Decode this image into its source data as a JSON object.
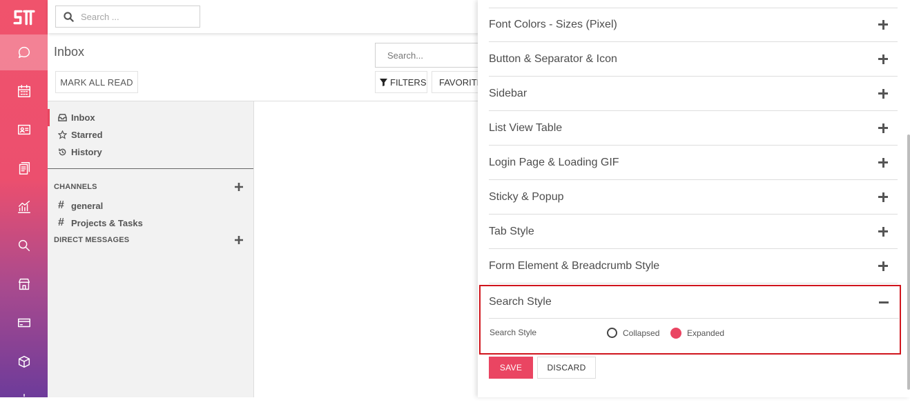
{
  "topbar": {
    "search_placeholder": "Search ..."
  },
  "appbar": {
    "items": [
      "discuss-icon",
      "calendar-icon",
      "contacts-icon",
      "documents-icon",
      "reports-icon",
      "search-icon",
      "store-icon",
      "card-icon",
      "package-icon",
      "settings-icon"
    ],
    "active": "discuss-icon"
  },
  "control_panel": {
    "title": "Inbox",
    "mark_all_read": "MARK ALL READ",
    "search_placeholder": "Search...",
    "filters_label": "FILTERS",
    "favorites_label": "FAVORITES"
  },
  "sidebar": {
    "mailboxes": [
      {
        "label": "Inbox",
        "icon": "inbox-icon",
        "active": true
      },
      {
        "label": "Starred",
        "icon": "star-icon"
      },
      {
        "label": "History",
        "icon": "history-icon"
      }
    ],
    "channels_title": "CHANNELS",
    "channels": [
      "general",
      "Projects & Tasks"
    ],
    "direct_messages_title": "DIRECT MESSAGES"
  },
  "theme_panel": {
    "sections": [
      "Font Colors - Sizes (Pixel)",
      "Button & Separator & Icon",
      "Sidebar",
      "List View Table",
      "Login Page & Loading GIF",
      "Sticky & Popup",
      "Tab Style",
      "Form Element & Breadcrumb Style"
    ],
    "expanded_section": {
      "title": "Search Style",
      "option_label": "Search Style",
      "choices": [
        "Collapsed",
        "Expanded"
      ],
      "selected": "Expanded"
    },
    "save_label": "SAVE",
    "discard_label": "DISCARD"
  },
  "colors": {
    "accent": "#ea4562",
    "highlight_border": "#d0141c"
  }
}
